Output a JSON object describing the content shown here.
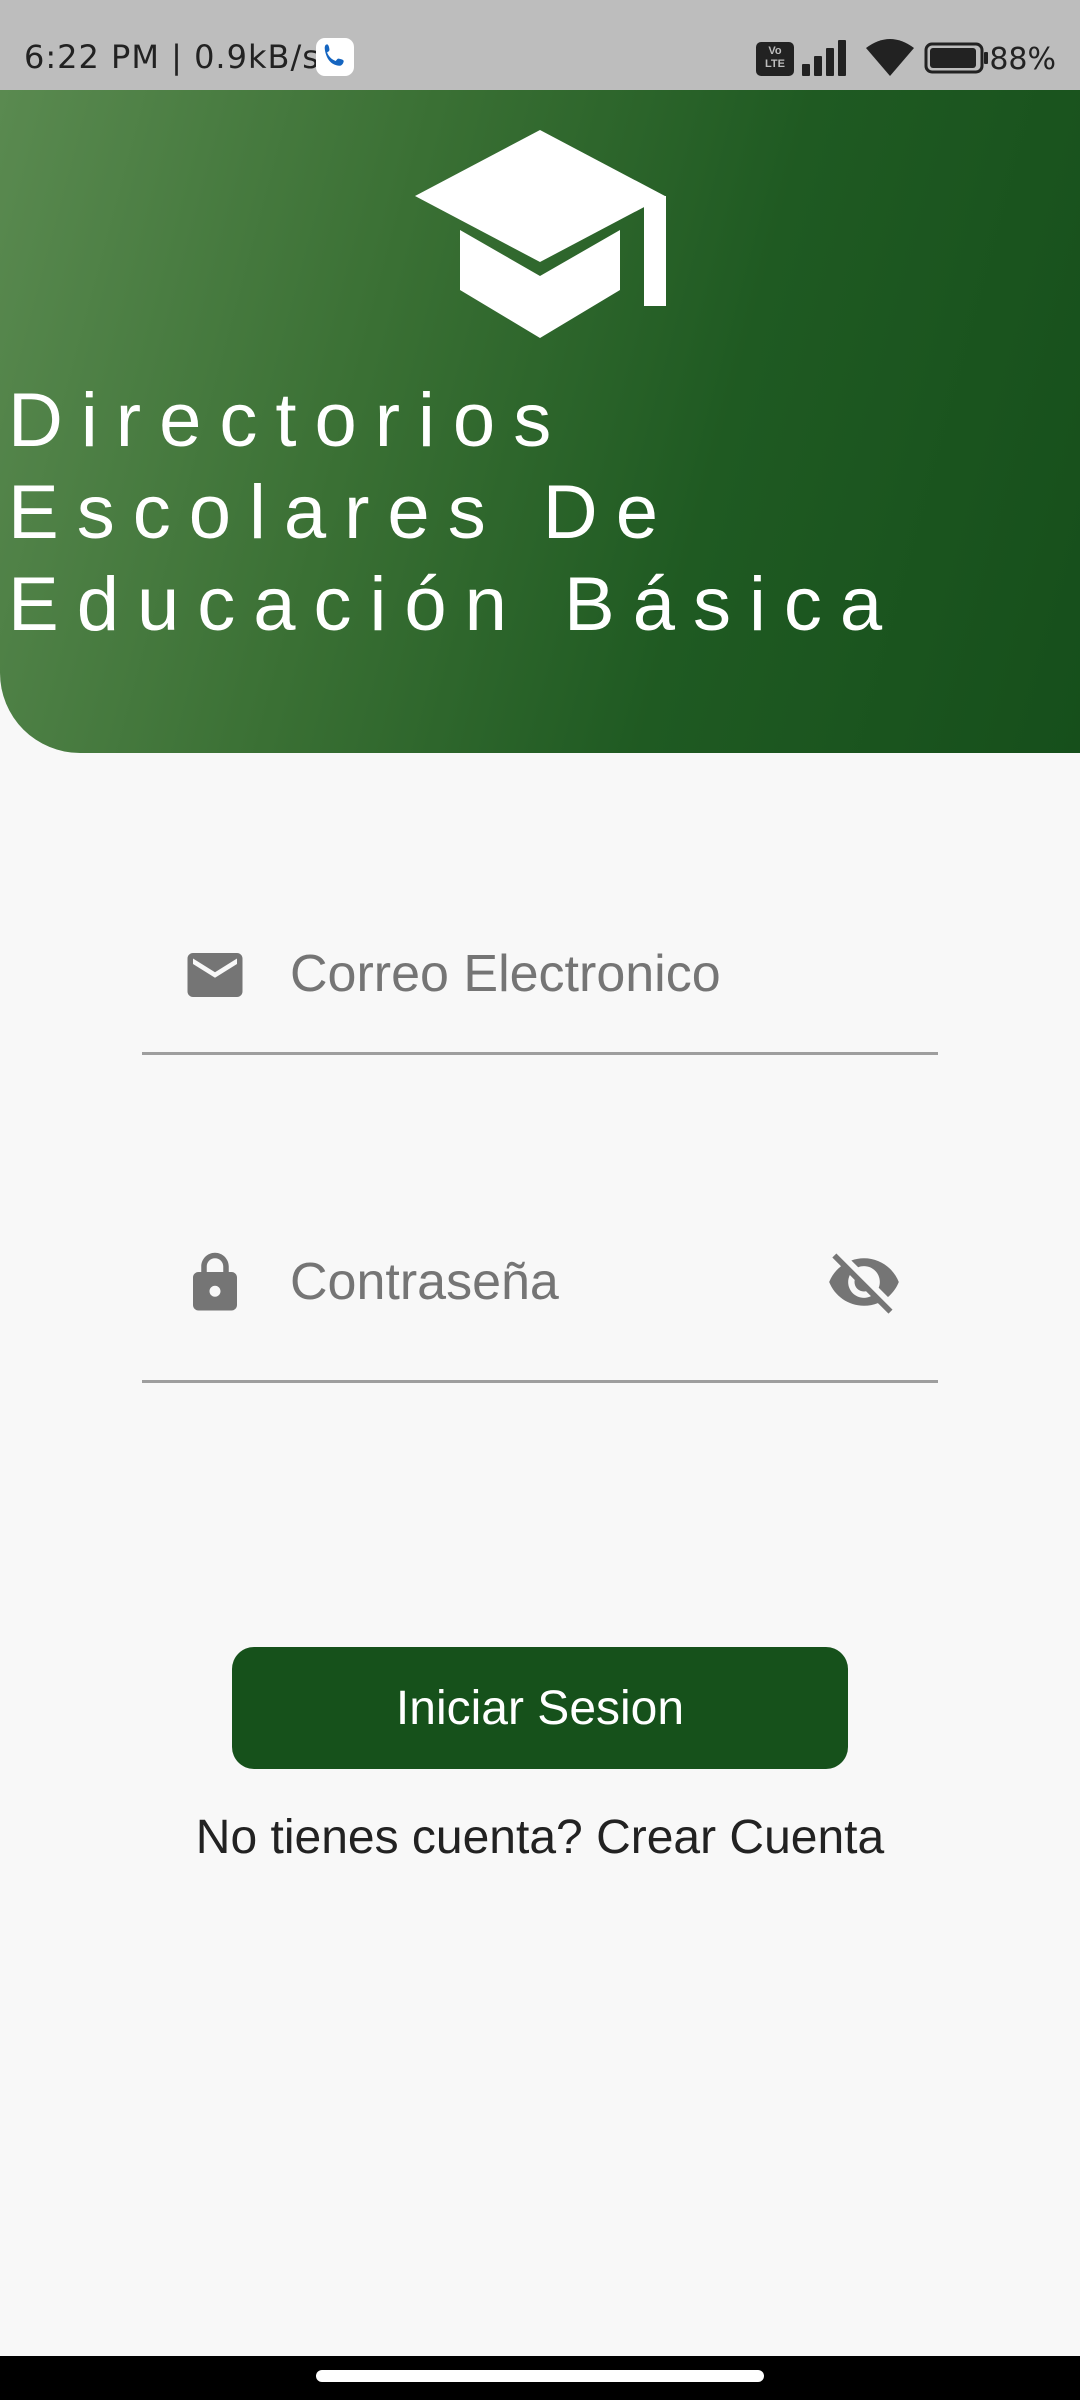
{
  "status_bar": {
    "left_text": "6:22 PM | 0.9kB/s",
    "volte_label": "Vo\nLTE",
    "battery_percent": "88%"
  },
  "header": {
    "title": "Directorios\nEscolares De\nEducación Básica",
    "icon": "graduation-cap-icon"
  },
  "form": {
    "email": {
      "placeholder": "Correo Electronico",
      "value": "",
      "icon": "email-icon"
    },
    "password": {
      "placeholder": "Contraseña",
      "value": "",
      "icon": "lock-icon",
      "toggle_icon": "eye-off-icon"
    },
    "login_label": "Iniciar Sesion",
    "signup_prompt": "No tienes cuenta?",
    "signup_link": "Crear Cuenta"
  },
  "colors": {
    "brand_green": "#16511b",
    "background": "#f8f8f8",
    "status_bar": "#bdbdbd"
  }
}
